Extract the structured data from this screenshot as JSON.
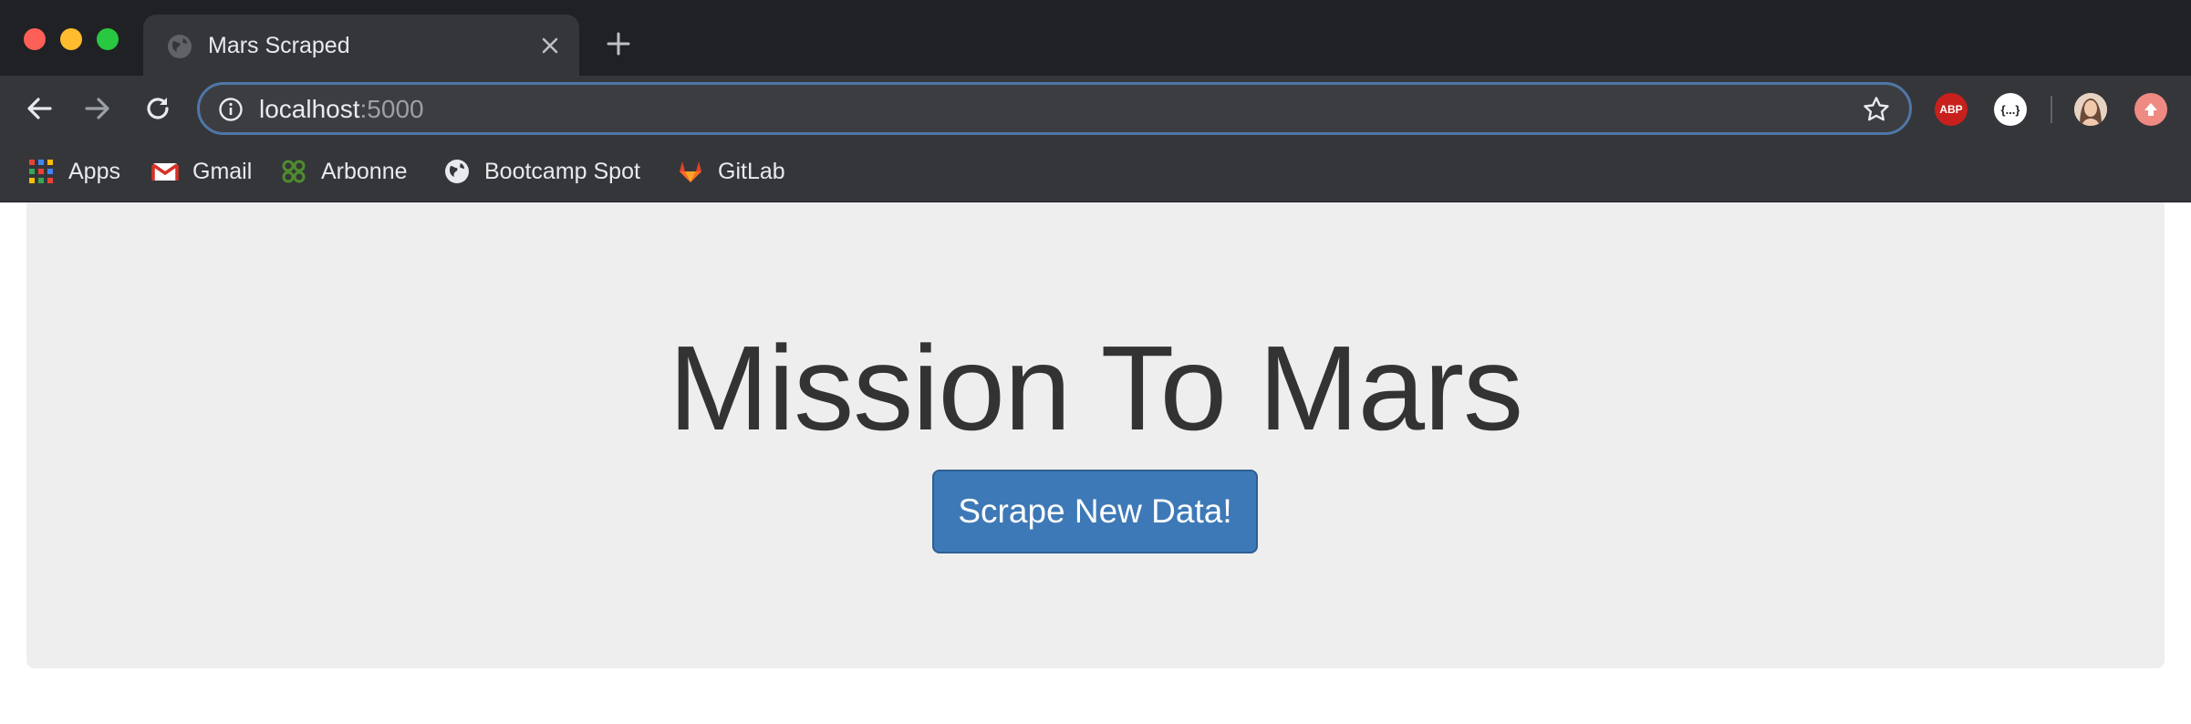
{
  "browser": {
    "tab": {
      "title": "Mars Scraped",
      "favicon": "globe-icon",
      "close_icon": "close-icon"
    },
    "new_tab_icon": "plus-icon",
    "nav": {
      "back_icon": "arrow-left-icon",
      "forward_icon": "arrow-right-icon",
      "reload_icon": "reload-icon"
    },
    "address_bar": {
      "host": "localhost",
      "port": ":5000",
      "info_icon": "info-icon",
      "bookmark_icon": "star-icon"
    },
    "extensions": [
      {
        "name": "adblock-plus-icon",
        "label": "ABP",
        "color": "#c8201d"
      },
      {
        "name": "json-viewer-icon",
        "label": "{...}",
        "color": "#ffffff"
      },
      {
        "name": "profile-avatar",
        "label": ""
      },
      {
        "name": "update-icon",
        "label": "",
        "color": "#ee8a82"
      }
    ],
    "bookmarks": [
      {
        "label": "Apps",
        "icon": "apps-grid-icon"
      },
      {
        "label": "Gmail",
        "icon": "gmail-icon"
      },
      {
        "label": "Arbonne",
        "icon": "arbonne-icon"
      },
      {
        "label": "Bootcamp Spot",
        "icon": "globe-icon"
      },
      {
        "label": "GitLab",
        "icon": "gitlab-icon"
      }
    ]
  },
  "page": {
    "headline": "Mission To Mars",
    "scrape_button": "Scrape New Data!",
    "colors": {
      "jumbotron": "#eeeeee",
      "button": "#3e79b7",
      "headline": "#333333"
    }
  }
}
